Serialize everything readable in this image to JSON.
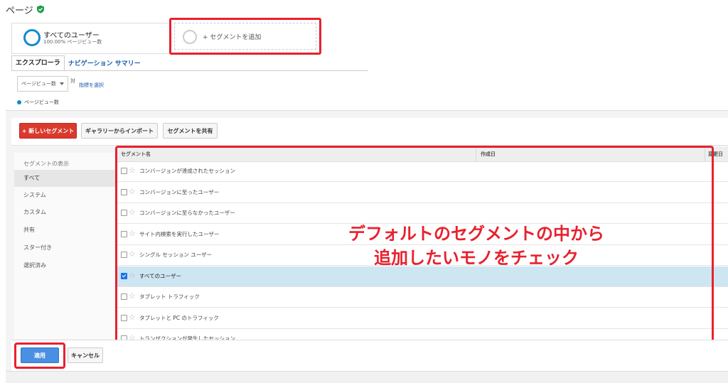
{
  "page": {
    "title": "ページ"
  },
  "segment_bar": {
    "active_segment": {
      "name": "すべてのユーザー",
      "subtext": "100.00% ページビュー数"
    },
    "add_segment_label": "+ セグメントを追加"
  },
  "tabs": [
    {
      "label": "エクスプローラ",
      "active": true
    },
    {
      "label": "ナビゲーション サマリー",
      "active": false
    }
  ],
  "metric_controls": {
    "primary_metric": "ページビュー数",
    "vs_label": "対",
    "select_metric_link": "指標を選択",
    "legend_label": "ページビュー数"
  },
  "toolbar": {
    "new_segment": "+ 新しいセグメント",
    "import_gallery": "ギャラリーからインポート",
    "share_segment": "セグメントを共有"
  },
  "sidebar": {
    "heading": "セグメントの表示",
    "items": [
      {
        "label": "すべて",
        "active": true
      },
      {
        "label": "システム",
        "active": false
      },
      {
        "label": "カスタム",
        "active": false
      },
      {
        "label": "共有",
        "active": false
      },
      {
        "label": "スター付き",
        "active": false
      },
      {
        "label": "選択済み",
        "active": false
      }
    ]
  },
  "table": {
    "columns": [
      "セグメント名",
      "作成日",
      "変更日"
    ],
    "rows": [
      {
        "label": "コンバージョンが達成されたセッション",
        "checked": false
      },
      {
        "label": "コンバージョンに至ったユーザー",
        "checked": false
      },
      {
        "label": "コンバージョンに至らなかったユーザー",
        "checked": false
      },
      {
        "label": "サイト内検索を実行したユーザー",
        "checked": false
      },
      {
        "label": "シングル セッション ユーザー",
        "checked": false
      },
      {
        "label": "すべてのユーザー",
        "checked": true
      },
      {
        "label": "タブレット トラフィック",
        "checked": false
      },
      {
        "label": "タブレットと PC のトラフィック",
        "checked": false
      },
      {
        "label": "トランザクションが発生したセッション",
        "checked": false
      }
    ]
  },
  "annotation": {
    "line1": "デフォルトのセグメントの中から",
    "line2": "追加したいモノをチェック"
  },
  "footer": {
    "apply": "適用",
    "cancel": "キャンセル"
  },
  "colors": {
    "highlight_red": "#e8212e",
    "segment_blue": "#0f8bd0",
    "new_button_red": "#d93a2d",
    "apply_blue": "#4a90e2",
    "selected_row": "#cde6f2"
  }
}
